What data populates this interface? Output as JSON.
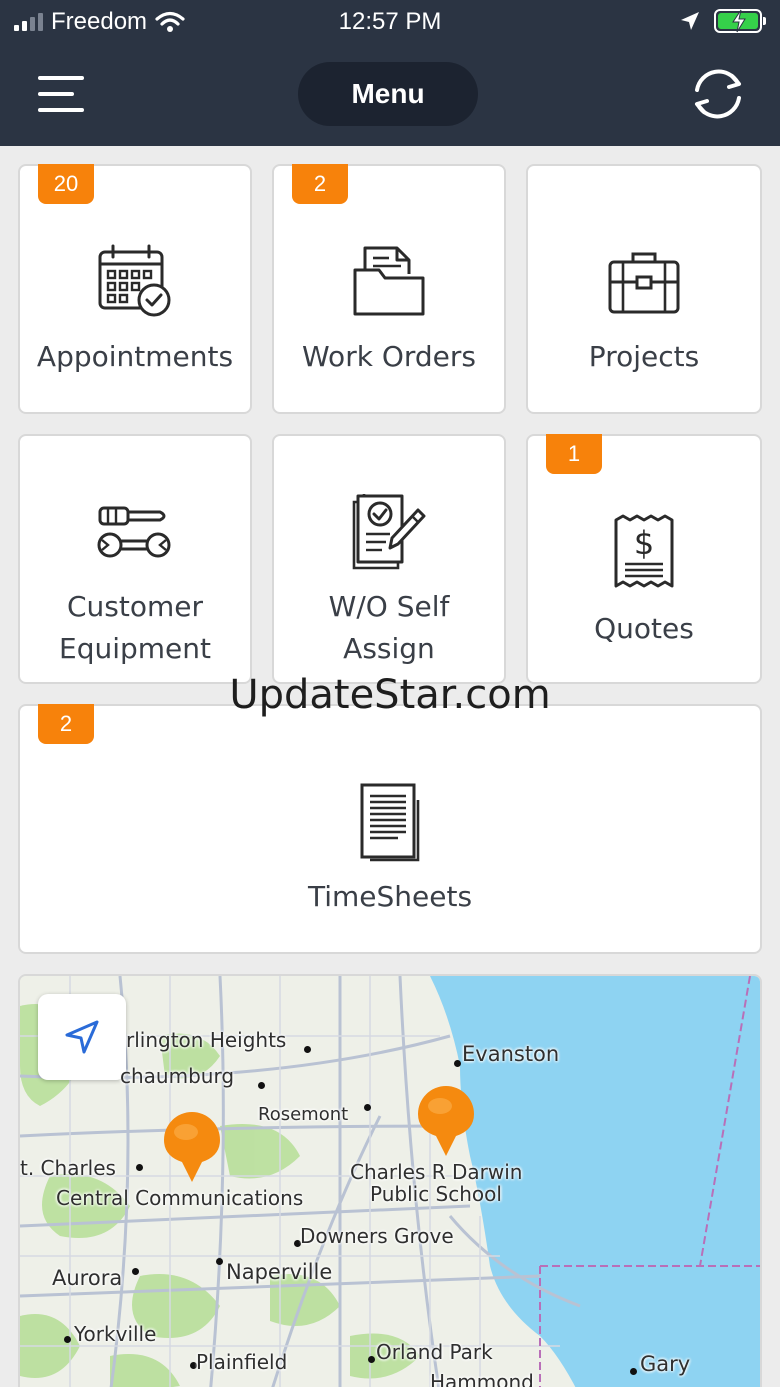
{
  "status_bar": {
    "carrier": "Freedom",
    "time": "12:57 PM"
  },
  "header": {
    "title": "Menu"
  },
  "tiles": [
    {
      "label": "Appointments",
      "badge": "20",
      "icon": "calendar-check-icon"
    },
    {
      "label": "Work Orders",
      "badge": "2",
      "icon": "folder-document-icon"
    },
    {
      "label": "Projects",
      "badge": "",
      "icon": "briefcase-icon"
    },
    {
      "label_line1": "Customer",
      "label_line2": "Equipment",
      "badge": "",
      "icon": "tools-icon"
    },
    {
      "label_line1": "W/O Self",
      "label_line2": "Assign",
      "badge": "",
      "icon": "document-pen-icon"
    },
    {
      "label": "Quotes",
      "badge": "1",
      "icon": "receipt-dollar-icon"
    },
    {
      "label": "TimeSheets",
      "badge": "2",
      "icon": "timesheet-icon"
    }
  ],
  "watermark": "UpdateStar.com",
  "map": {
    "labels": {
      "arlington": "rlington Heights",
      "schaumburg": "chaumburg",
      "rosemont": "Rosemont",
      "evanston": "Evanston",
      "st_charles": "t. Charles",
      "central": "Central Communications",
      "darwin1": "Charles R Darwin",
      "darwin2": "Public School",
      "downers": "Downers Grove",
      "aurora": "Aurora",
      "naperville": "Naperville",
      "yorkville": "Yorkville",
      "plainfield": "Plainfield",
      "orland": "Orland Park",
      "gary": "Gary",
      "hammond": "Hammond"
    },
    "colors": {
      "water": "#8ed3f2",
      "park": "#b8df9a",
      "pin": "#f58a0f"
    }
  },
  "colors": {
    "header_bg": "#2b3443",
    "badge": "#f7820b"
  }
}
